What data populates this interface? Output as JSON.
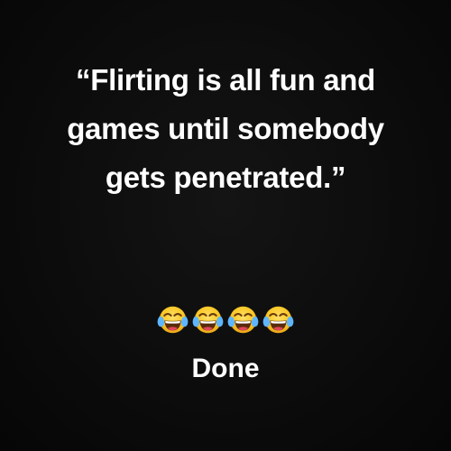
{
  "quote": {
    "lines": [
      "“Flirting is all fun and",
      "games until somebody",
      "gets penetrated.”"
    ]
  },
  "emojis": {
    "icon": "face-with-tears-of-joy-icon",
    "count": 4
  },
  "caption": "Done"
}
